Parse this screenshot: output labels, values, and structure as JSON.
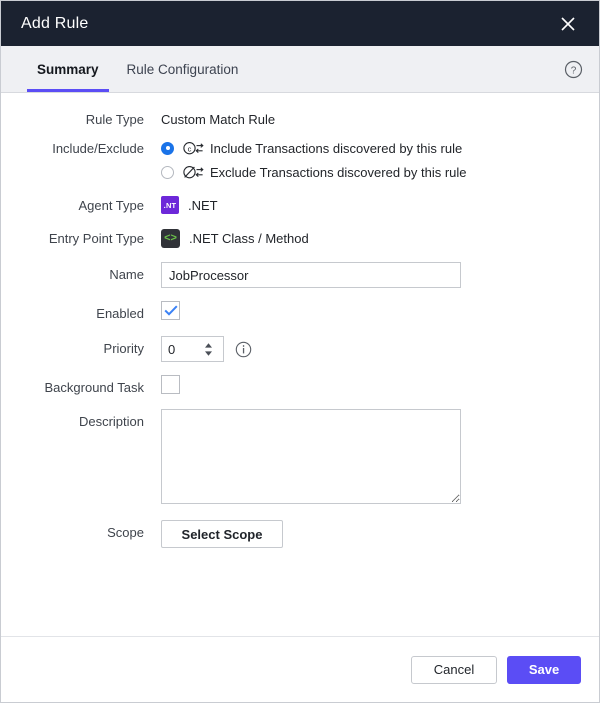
{
  "window": {
    "title": "Add Rule",
    "close_icon": "close-icon"
  },
  "tabs": {
    "items": [
      {
        "label": "Summary",
        "active": true
      },
      {
        "label": "Rule Configuration",
        "active": false
      }
    ],
    "help_icon": "help-circle-icon"
  },
  "form": {
    "rule_type": {
      "label": "Rule Type",
      "value": "Custom Match Rule"
    },
    "include_exclude": {
      "label": "Include/Exclude",
      "options": [
        {
          "text": "Include Transactions discovered by this rule",
          "selected": true,
          "icon": "include-transactions-icon"
        },
        {
          "text": "Exclude Transactions discovered by this rule",
          "selected": false,
          "icon": "exclude-transactions-icon"
        }
      ]
    },
    "agent_type": {
      "label": "Agent Type",
      "badge": ".NT",
      "value": ".NET"
    },
    "entry_point_type": {
      "label": "Entry Point Type",
      "badge": "<>",
      "value": ".NET Class / Method"
    },
    "name": {
      "label": "Name",
      "value": "JobProcessor",
      "placeholder": ""
    },
    "enabled": {
      "label": "Enabled",
      "checked": true
    },
    "priority": {
      "label": "Priority",
      "value": "0",
      "info_icon": "info-circle-icon"
    },
    "background_task": {
      "label": "Background Task",
      "checked": false
    },
    "description": {
      "label": "Description",
      "value": "",
      "placeholder": ""
    },
    "scope": {
      "label": "Scope",
      "button_label": "Select Scope"
    }
  },
  "footer": {
    "cancel_label": "Cancel",
    "save_label": "Save"
  },
  "colors": {
    "titlebar_bg": "#1b2230",
    "accent_purple": "#5b4df5",
    "agent_badge_purple": "#6d28d9",
    "code_badge_green": "#6cc24a",
    "radio_blue": "#1a73e8",
    "check_blue": "#3b82f6"
  }
}
